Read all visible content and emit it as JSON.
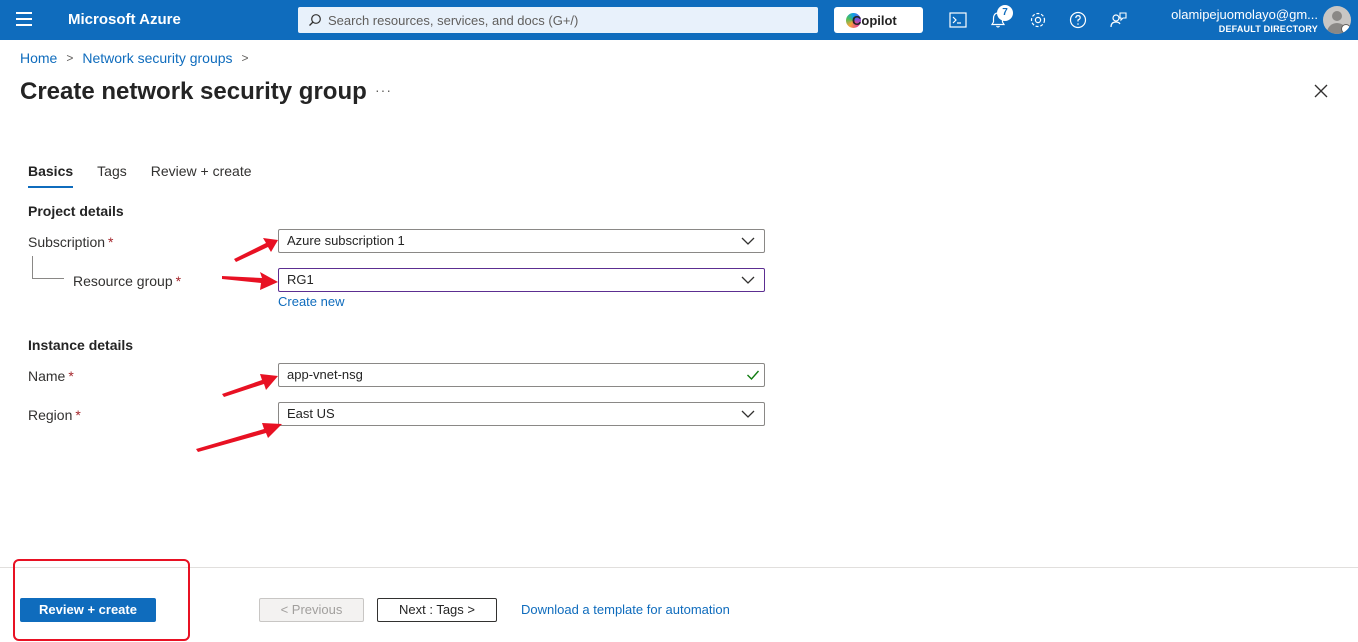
{
  "topbar": {
    "brand": "Microsoft Azure",
    "search_placeholder": "Search resources, services, and docs (G+/)",
    "copilot_label": "Copilot",
    "notification_count": "7",
    "user_email": "olamipejuomolayo@gm...",
    "user_directory": "DEFAULT DIRECTORY",
    "icons": [
      "menu-icon",
      "search-icon",
      "copilot-icon",
      "cloud-shell-icon",
      "bell-icon",
      "gear-icon",
      "help-icon",
      "feedback-icon",
      "avatar"
    ]
  },
  "breadcrumb": {
    "home": "Home",
    "parent": "Network security groups",
    "sep": ">"
  },
  "page": {
    "title": "Create network security group",
    "more": "···"
  },
  "tabs": [
    "Basics",
    "Tags",
    "Review + create"
  ],
  "form": {
    "project_details": "Project details",
    "subscription_label": "Subscription",
    "subscription_value": "Azure subscription 1",
    "resource_group_label": "Resource group",
    "resource_group_value": "RG1",
    "create_new": "Create new",
    "instance_details": "Instance details",
    "name_label": "Name",
    "name_value": "app-vnet-nsg",
    "region_label": "Region",
    "region_value": "East US",
    "required_mark": "*"
  },
  "footer": {
    "review_create": "Review + create",
    "previous": "< Previous",
    "next": "Next : Tags >",
    "template_link": "Download a template for automation"
  },
  "colors": {
    "accent": "#0f6cbd",
    "required": "#a4262c",
    "annotation": "#e81123",
    "valid": "#107c10"
  }
}
